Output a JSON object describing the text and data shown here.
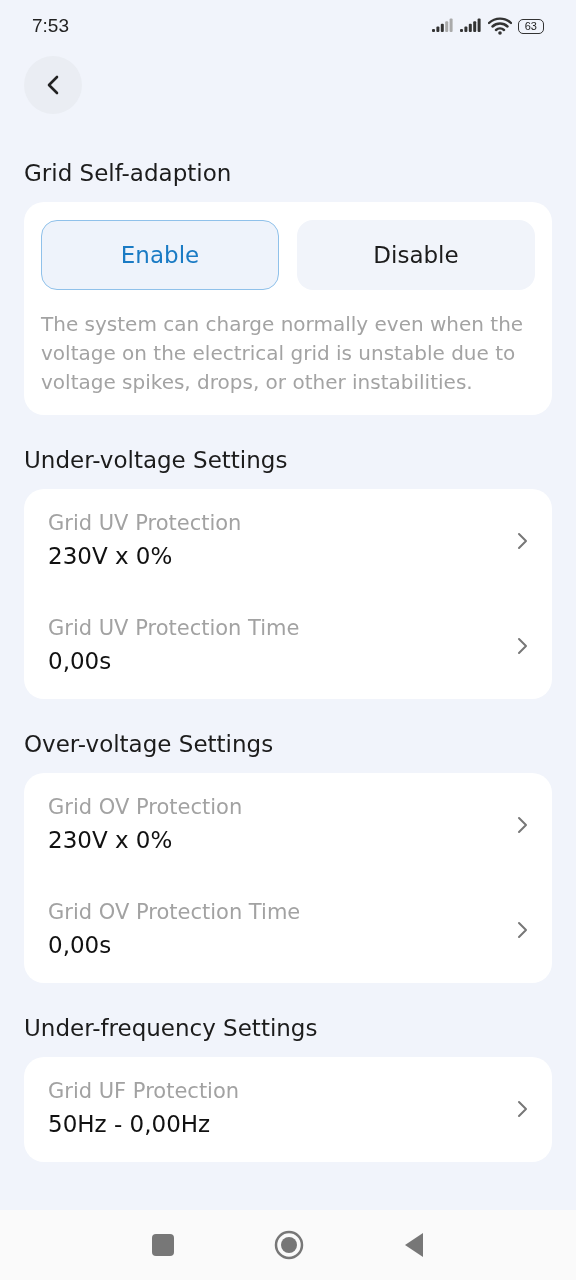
{
  "status_bar": {
    "time": "7:53",
    "battery": "63"
  },
  "sections": [
    {
      "title": "Grid Self-adaption",
      "kind": "toggle",
      "options": [
        {
          "label": "Enable",
          "selected": true
        },
        {
          "label": "Disable",
          "selected": false
        }
      ],
      "description": "The system can charge normally even when the voltage on the electrical grid is unstable due to voltage spikes, drops, or other instabilities."
    },
    {
      "title": "Under-voltage Settings",
      "kind": "list",
      "items": [
        {
          "label": "Grid UV Protection",
          "value": "230V x 0%"
        },
        {
          "label": "Grid UV Protection Time",
          "value": "0,00s"
        }
      ]
    },
    {
      "title": "Over-voltage Settings",
      "kind": "list",
      "items": [
        {
          "label": "Grid OV Protection",
          "value": "230V x 0%"
        },
        {
          "label": "Grid OV Protection Time",
          "value": "0,00s"
        }
      ]
    },
    {
      "title": "Under-frequency Settings",
      "kind": "list",
      "items": [
        {
          "label": "Grid UF Protection",
          "value": "50Hz - 0,00Hz"
        }
      ]
    }
  ]
}
